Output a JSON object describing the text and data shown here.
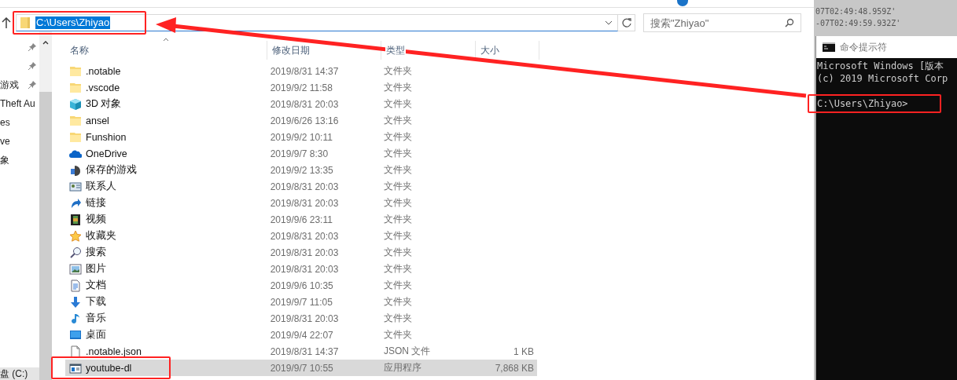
{
  "address_bar": {
    "path": "C:\\Users\\Zhiyao",
    "selected_text": true
  },
  "search": {
    "placeholder": "搜索\"Zhiyao\""
  },
  "nav_pane": {
    "items": [
      {
        "pinned": true,
        "kind": "item"
      },
      {
        "pinned": true,
        "kind": "item"
      },
      {
        "label": "游戏",
        "pinned": true,
        "kind": "item"
      },
      {
        "label": "Theft Au",
        "pinned": false,
        "kind": "item"
      },
      {
        "label": "es",
        "pinned": false,
        "kind": "item"
      },
      {
        "label": "ve",
        "pinned": false,
        "kind": "item"
      },
      {
        "label": "象",
        "pinned": false,
        "kind": "item"
      },
      {
        "label": "盘 (C:)",
        "pinned": false,
        "kind": "drive"
      }
    ]
  },
  "file_list": {
    "columns": [
      "名称",
      "修改日期",
      "类型",
      "大小"
    ],
    "rows": [
      {
        "name": ".notable",
        "date": "2019/8/31 14:37",
        "type": "文件夹",
        "kind": "folder",
        "selected": false
      },
      {
        "name": ".vscode",
        "date": "2019/9/2 11:58",
        "type": "文件夹",
        "kind": "folder",
        "selected": false
      },
      {
        "name": "3D 对象",
        "date": "2019/8/31 20:03",
        "type": "文件夹",
        "kind": "cube",
        "selected": false
      },
      {
        "name": "ansel",
        "date": "2019/6/26 13:16",
        "type": "文件夹",
        "kind": "folder",
        "selected": false
      },
      {
        "name": "Funshion",
        "date": "2019/9/2 10:11",
        "type": "文件夹",
        "kind": "folder",
        "selected": false
      },
      {
        "name": "OneDrive",
        "date": "2019/9/7 8:30",
        "type": "文件夹",
        "kind": "cloud",
        "selected": false
      },
      {
        "name": "保存的游戏",
        "date": "2019/9/2 13:35",
        "type": "文件夹",
        "kind": "games",
        "selected": false
      },
      {
        "name": "联系人",
        "date": "2019/8/31 20:03",
        "type": "文件夹",
        "kind": "contacts",
        "selected": false
      },
      {
        "name": "链接",
        "date": "2019/8/31 20:03",
        "type": "文件夹",
        "kind": "link",
        "selected": false
      },
      {
        "name": "视频",
        "date": "2019/9/6 23:11",
        "type": "文件夹",
        "kind": "video",
        "selected": false
      },
      {
        "name": "收藏夹",
        "date": "2019/8/31 20:03",
        "type": "文件夹",
        "kind": "star",
        "selected": false
      },
      {
        "name": "搜索",
        "date": "2019/8/31 20:03",
        "type": "文件夹",
        "kind": "search",
        "selected": false
      },
      {
        "name": "图片",
        "date": "2019/8/31 20:03",
        "type": "文件夹",
        "kind": "pictures",
        "selected": false
      },
      {
        "name": "文档",
        "date": "2019/9/6 10:35",
        "type": "文件夹",
        "kind": "document",
        "selected": false
      },
      {
        "name": "下载",
        "date": "2019/9/7 11:05",
        "type": "文件夹",
        "kind": "download",
        "selected": false
      },
      {
        "name": "音乐",
        "date": "2019/8/31 20:03",
        "type": "文件夹",
        "kind": "music",
        "selected": false
      },
      {
        "name": "桌面",
        "date": "2019/9/4 22:07",
        "type": "文件夹",
        "kind": "desktop",
        "selected": false
      },
      {
        "name": ".notable.json",
        "date": "2019/8/31 14:37",
        "type": "JSON 文件",
        "size": "1 KB",
        "kind": "file",
        "selected": false
      },
      {
        "name": "youtube-dl",
        "date": "2019/9/7 10:55",
        "type": "应用程序",
        "size": "7,868 KB",
        "kind": "app",
        "selected": true
      }
    ]
  },
  "background_window": {
    "lines": [
      "07T02:49:48.959Z'",
      "-07T02:49:59.932Z'"
    ]
  },
  "console": {
    "title": "命令提示符",
    "lines": [
      {
        "text": "Microsoft Windows [版本",
        "kind": "output"
      },
      {
        "text": "(c) 2019 Microsoft Corp",
        "kind": "output"
      },
      {
        "text": "C:\\Users\\Zhiyao>",
        "kind": "prompt"
      }
    ]
  },
  "annotations": [
    {
      "kind": "address"
    },
    {
      "kind": "prompt"
    },
    {
      "kind": "selection"
    },
    {
      "kind": "arrow"
    }
  ]
}
